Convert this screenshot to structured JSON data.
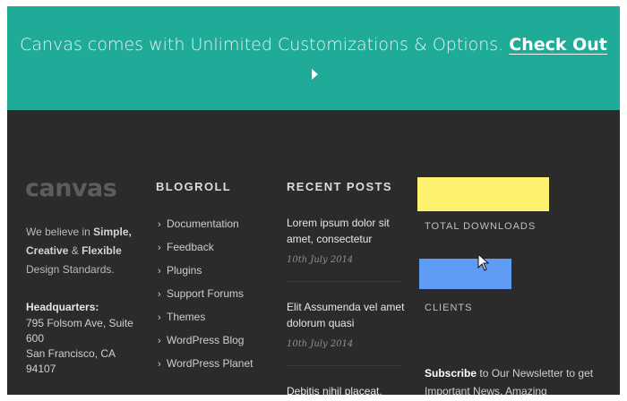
{
  "banner": {
    "text": "Canvas comes with Unlimited Customizations & Options.",
    "link_label": "Check Out",
    "icon": "play-icon"
  },
  "brand": {
    "logo_text": "canvas",
    "tagline_prefix": "We believe in",
    "tagline_bold_1": "Simple,",
    "tagline_bold_2": "Creative",
    "tagline_amp": "&",
    "tagline_bold_3": "Flexible",
    "tagline_suffix": "Design Standards."
  },
  "headquarters": {
    "title": "Headquarters:",
    "lines": [
      "795 Folsom Ave, Suite",
      "600",
      "San Francisco, CA",
      "94107"
    ]
  },
  "blogroll": {
    "heading": "BLOGROLL",
    "items": [
      "Documentation",
      "Feedback",
      "Plugins",
      "Support Forums",
      "Themes",
      "WordPress Blog",
      "WordPress Planet"
    ]
  },
  "recent_posts": {
    "heading": "RECENT POSTS",
    "posts": [
      {
        "title": "Lorem ipsum dolor sit amet, consectetur",
        "date": "10th July 2014"
      },
      {
        "title": "Elit Assumenda vel amet dolorum quasi",
        "date": "10th July 2014"
      },
      {
        "title": "Debitis nihil placeat,",
        "date": ""
      }
    ]
  },
  "stats": {
    "downloads_label": "TOTAL DOWNLOADS",
    "clients_label": "CLIENTS"
  },
  "newsletter": {
    "bold": "Subscribe",
    "text": "to Our Newsletter to get Important News, Amazing"
  },
  "colors": {
    "banner_bg": "#1fab98",
    "footer_bg": "#2b2b2b",
    "downloads_bar": "#fff170",
    "clients_bar": "#5e9cf6"
  }
}
